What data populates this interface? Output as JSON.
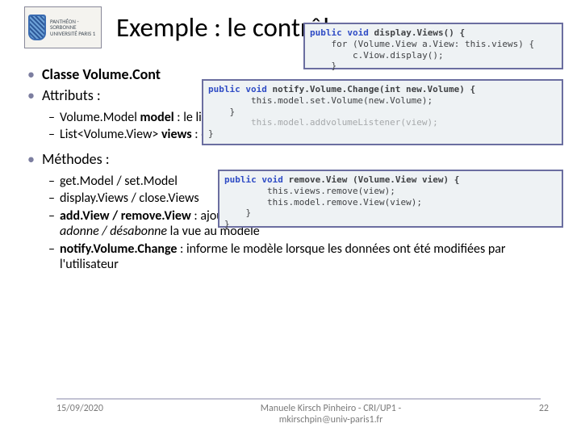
{
  "logo": {
    "line1": "PANTHÉON - SORBONNE",
    "line2": "UNIVERSITÉ PARIS 1"
  },
  "title": "Exemple : le contrôleur",
  "bullets": {
    "classLine": "Classe Volume.Cont",
    "attributesLabel": "Attributs :",
    "attrItems": [
      {
        "prefix": "Volume.Model ",
        "bold": "model",
        "suffix": " : le lien"
      },
      {
        "prefix": "List<Volume.View> ",
        "bold": "views",
        "suffix": " : en"
      }
    ],
    "methodsLabel": "Méthodes :",
    "methodItems": [
      "get.Model / set.Model",
      "display.Views / close.Views"
    ],
    "methodAddView": {
      "bold": "add.View / remove.View",
      "rest": " : ajoute / enlève une vue de la liste internet et ",
      "italicLine": "adonne / désabonne",
      "rest2": " la vue au modèle"
    },
    "methodNotify": {
      "bold": "notify.Volume.Change",
      "rest": " : informe le modèle lorsque les données ont été modifiées par l'utilisateur"
    }
  },
  "code1": [
    {
      "kw": "public void",
      "body": " display.Views() {"
    },
    {
      "plain": "    for (Volume.View a.View: this.views) {"
    },
    {
      "plain": "        c.Viow.display();"
    },
    {
      "plain": "    }"
    }
  ],
  "code2": [
    {
      "kw": "public void",
      "body": " notify.Volume.Change(int new.Volume) {"
    },
    {
      "plain": "        this.model.set.Volume(new.Volume);"
    },
    {
      "plain": "    }"
    },
    {
      "faded": "        this.model.addvolumeListener(view);"
    },
    {
      "plain": "}"
    }
  ],
  "code3": [
    {
      "kw": "public void",
      "body": " remove.View (Volume.View view) {"
    },
    {
      "plain": "        this.views.remove(view);"
    },
    {
      "plain": "        this.model.remove.View(view);"
    },
    {
      "plain": "    }"
    },
    {
      "plain": "}"
    }
  ],
  "footer": {
    "date": "15/09/2020",
    "author_line1": "Manuele Kirsch Pinheiro - CRI/UP1 -",
    "author_line2": "mkirschpin@univ-paris1.fr",
    "page": "22"
  }
}
